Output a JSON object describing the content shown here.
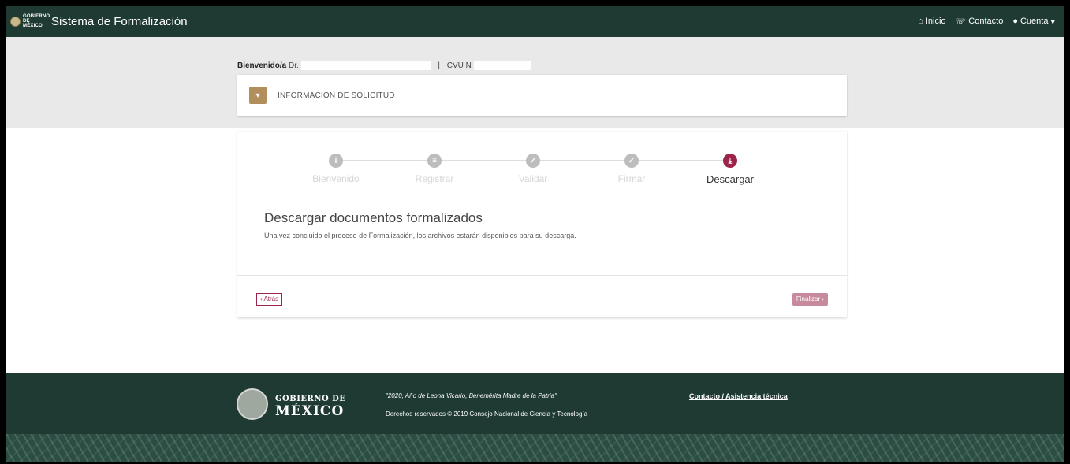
{
  "navbar": {
    "logo_text": "GOBIERNO DE MÉXICO",
    "brand": "Sistema de Formalización",
    "links": [
      {
        "icon": "home-icon",
        "label": "Inicio"
      },
      {
        "icon": "contact-icon",
        "label": "Contacto"
      },
      {
        "icon": "user-icon",
        "label": "Cuenta"
      }
    ]
  },
  "header": {
    "welcome_label": "Bienvenido/a",
    "welcome_name": "Dr.",
    "separator": "|",
    "cvu_label": "CVU N"
  },
  "info_card": {
    "label": "INFORMACIÓN DE SOLICITUD"
  },
  "steps": [
    {
      "label": "Bienvenido",
      "icon": "info-icon",
      "glyph": "i",
      "active": false
    },
    {
      "label": "Registrar",
      "icon": "list-icon",
      "glyph": "≡",
      "active": false
    },
    {
      "label": "Validar",
      "icon": "check-icon",
      "glyph": "✓",
      "active": false
    },
    {
      "label": "Firmar",
      "icon": "check-icon",
      "glyph": "✓",
      "active": false
    },
    {
      "label": "Descargar",
      "icon": "download-icon",
      "glyph": "⤓",
      "active": true
    }
  ],
  "download": {
    "title": "Descargar documentos formalizados",
    "description": "Una vez concluido el proceso de Formalización, los archivos estarán disponibles para su descarga."
  },
  "buttons": {
    "back": "‹ Atrás",
    "finish": "Finalizar ›"
  },
  "footer": {
    "gov_line1": "GOBIERNO DE",
    "gov_line2": "MÉXICO",
    "motto": "\"2020, Año de Leona Vicario, Benemérita Madre de la Patria\"",
    "rights": "Derechos reservados © 2019 Consejo Nacional de Ciencia y Tecnología",
    "contact": "Contacto / Asistencia técnica"
  },
  "colors": {
    "primary_green": "#1e3a33",
    "accent_gold": "#b38e5d",
    "accent_wine": "#9d2449"
  }
}
